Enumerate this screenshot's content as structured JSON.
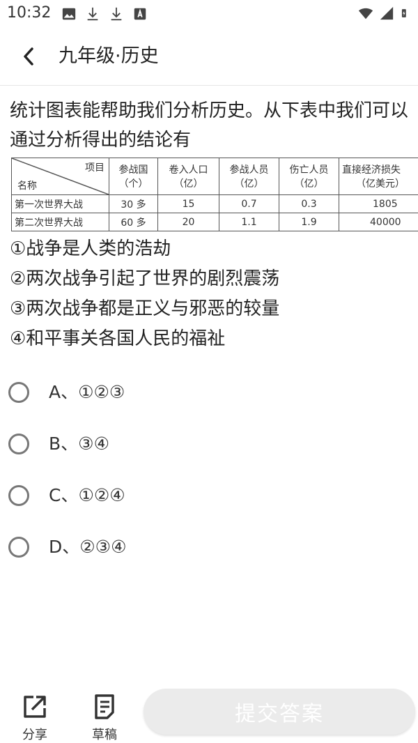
{
  "status_bar": {
    "time": "10:32",
    "left_icons": [
      "image-icon",
      "download-icon",
      "download-icon",
      "translate-icon"
    ],
    "right_icons": [
      "wifi-icon",
      "signal-icon",
      "battery-icon"
    ]
  },
  "app_bar": {
    "title": "九年级·历史"
  },
  "question": {
    "text": "统计图表能帮助我们分析历史。从下表中我们可以通过分析得出的结论有",
    "table": {
      "corner_top": "项目",
      "corner_bottom": "名称",
      "headers": [
        [
          "参战国",
          "（个）"
        ],
        [
          "卷入人口",
          "（亿）"
        ],
        [
          "参战人员",
          "（亿）"
        ],
        [
          "伤亡人员",
          "（亿）"
        ],
        [
          "直接经济损失",
          "（亿美元）"
        ]
      ],
      "rows": [
        {
          "name": "第一次世界大战",
          "cells": [
            "30 多",
            "15",
            "0.7",
            "0.3",
            "1805"
          ]
        },
        {
          "name": "第二次世界大战",
          "cells": [
            "60 多",
            "20",
            "1.1",
            "1.9",
            "40000"
          ]
        }
      ]
    },
    "statements": [
      "①战争是人类的浩劫",
      "②两次战争引起了世界的剧烈震荡",
      "③两次战争都是正义与邪恶的较量",
      "④和平事关各国人民的福祉"
    ]
  },
  "options": [
    {
      "label": "A、①②③"
    },
    {
      "label": "B、③④"
    },
    {
      "label": "C、①②④"
    },
    {
      "label": "D、②③④"
    }
  ],
  "bottom_bar": {
    "share_label": "分享",
    "draft_label": "草稿",
    "submit_label": "提交答案",
    "submit_color": "#ebebeb"
  }
}
